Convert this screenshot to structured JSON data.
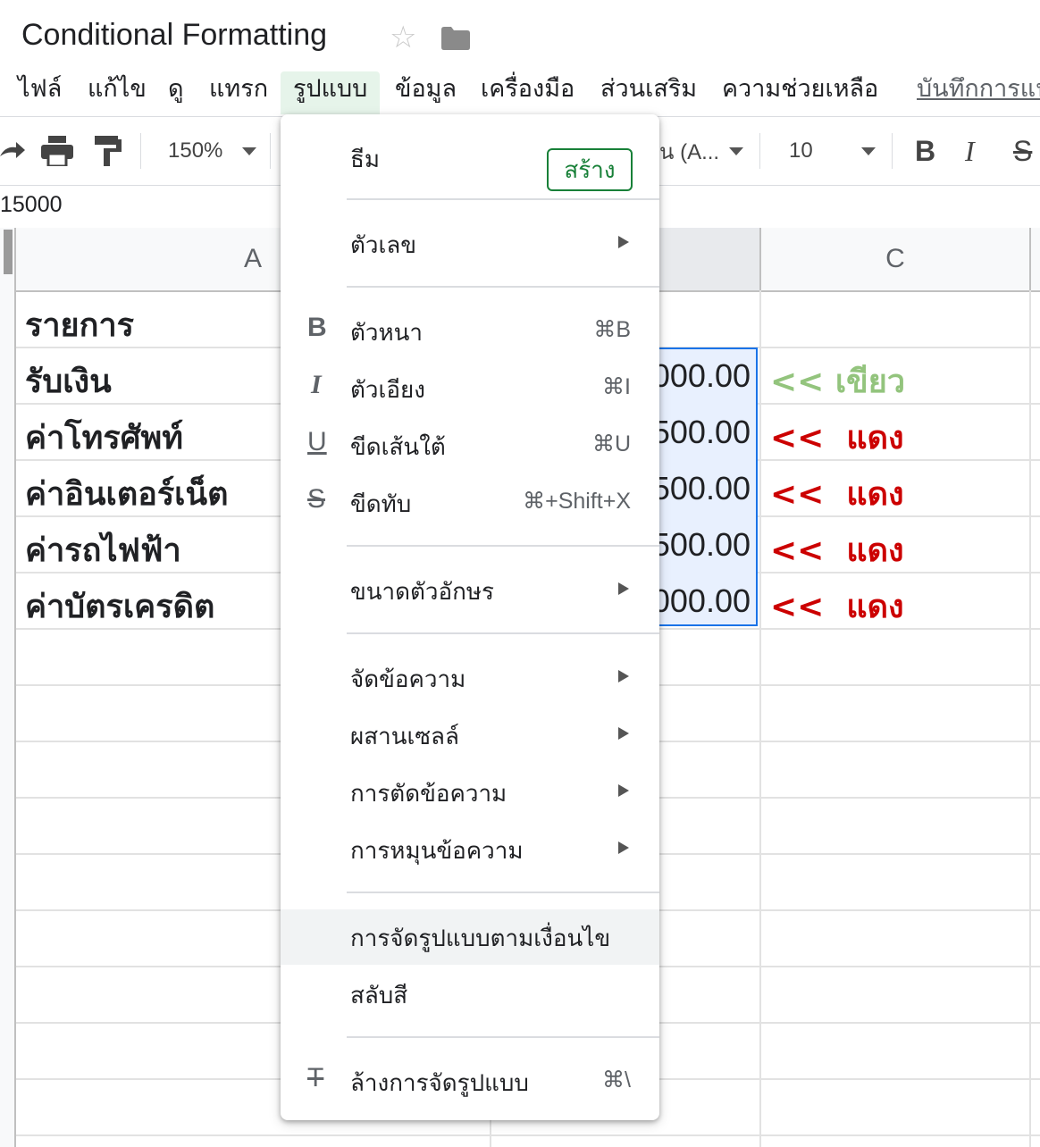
{
  "title": {
    "doc_name": "Conditional Formatting"
  },
  "menubar": {
    "items": [
      "ไฟล์",
      "แก้ไข",
      "ดู",
      "แทรก",
      "รูปแบบ",
      "ข้อมูล",
      "เครื่องมือ",
      "ส่วนเสริม",
      "ความช่วยเหลือ"
    ],
    "last_edit": "บันทึกการแป"
  },
  "toolbar": {
    "zoom": "150%",
    "font_partial": "น (A...",
    "font_size": "10",
    "bold": "B",
    "italic": "I",
    "strike": "S"
  },
  "formula_bar": {
    "value": "15000"
  },
  "columns": [
    "A",
    "C"
  ],
  "cells": {
    "A": [
      "รายการ",
      "รับเงิน",
      "ค่าโทรศัพท์",
      "ค่าอินเตอร์เน็ต",
      "ค่ารถไฟฟ้า",
      "ค่าบัตรเครดิต"
    ],
    "B": [
      "",
      "000.00",
      "500.00",
      "500.00",
      "500.00",
      "000.00"
    ],
    "C": [
      "",
      "<< เขียว",
      "<<  แดง",
      "<<  แดง",
      "<<  แดง",
      "<<  แดง"
    ]
  },
  "colors": {
    "green": "#93c47d",
    "red": "#cc0000",
    "selection_fill": "#e8f0fe",
    "selection_border": "#1a73e8"
  },
  "format_menu": {
    "theme": "ธีม",
    "create": "สร้าง",
    "number": "ตัวเลข",
    "bold": "ตัวหนา",
    "bold_short": "⌘B",
    "italic": "ตัวเอียง",
    "italic_short": "⌘I",
    "underline": "ขีดเส้นใต้",
    "underline_short": "⌘U",
    "strike": "ขีดทับ",
    "strike_short": "⌘+Shift+X",
    "font_size": "ขนาดตัวอักษร",
    "align": "จัดข้อความ",
    "merge": "ผสานเซลล์",
    "wrap": "การตัดข้อความ",
    "rotate": "การหมุนข้อความ",
    "conditional": "การจัดรูปแบบตามเงื่อนไข",
    "alternating": "สลับสี",
    "clear": "ล้างการจัดรูปแบบ",
    "clear_short": "⌘\\"
  }
}
